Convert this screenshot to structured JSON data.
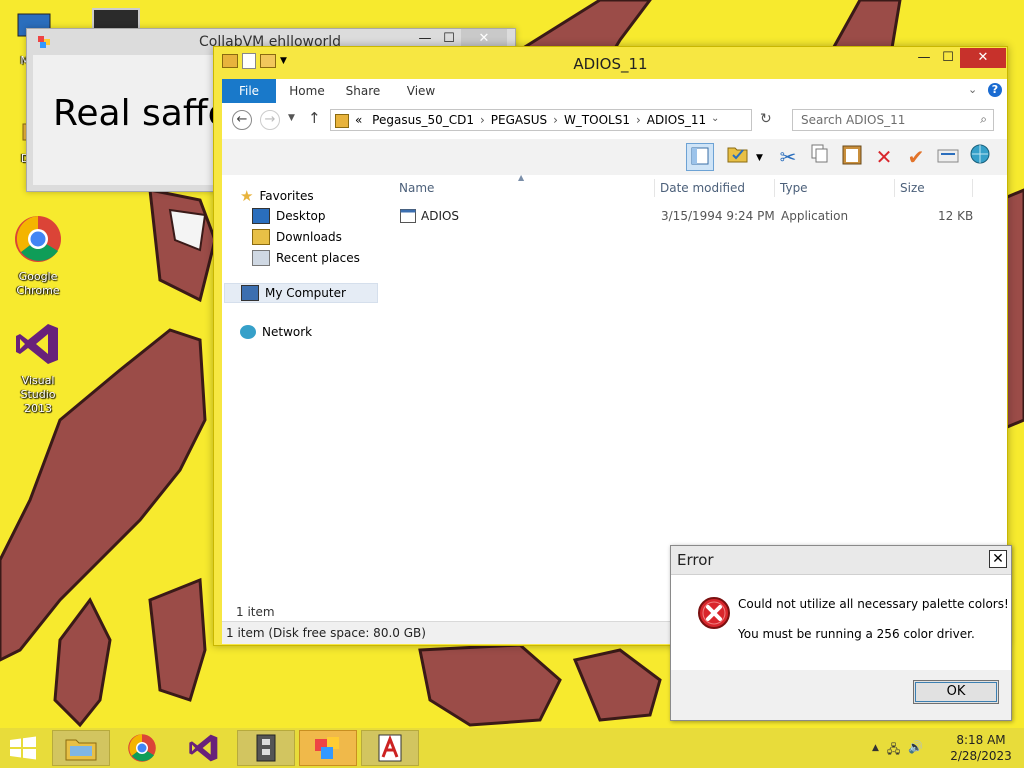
{
  "desktop": {
    "icons": [
      {
        "label": "My C",
        "icon": "computer-icon"
      },
      {
        "label": "Data",
        "icon": "folder-icon"
      },
      {
        "label": "Google Chrome",
        "icon": "chrome-icon"
      },
      {
        "label": "Visual Studio 2013",
        "icon": "visual-studio-icon"
      }
    ]
  },
  "collab_window": {
    "title": "CollabVM ehlloworld",
    "body_text": "Real saffe"
  },
  "explorer": {
    "title": "ADIOS_11",
    "ribbon_tabs": [
      "File",
      "Home",
      "Share",
      "View"
    ],
    "address": {
      "prefix": "«",
      "crumbs": [
        "Pegasus_50_CD1",
        "PEGASUS",
        "W_TOOLS1",
        "ADIOS_11"
      ]
    },
    "search_placeholder": "Search ADIOS_11",
    "nav": {
      "favorites": "Favorites",
      "desktop": "Desktop",
      "downloads": "Downloads",
      "recent": "Recent places",
      "my_computer": "My Computer",
      "network": "Network"
    },
    "columns": {
      "name": "Name",
      "date": "Date modified",
      "type": "Type",
      "size": "Size"
    },
    "files": [
      {
        "name": "ADIOS",
        "date": "3/15/1994 9:24 PM",
        "type": "Application",
        "size": "12 KB"
      }
    ],
    "status_count": "1 item",
    "status_disk": "1 item (Disk free space: 80.0 GB)"
  },
  "error_dialog": {
    "title": "Error",
    "line1": "Could not utilize all necessary palette colors!",
    "line2": "You must be running a 256 color driver.",
    "ok_label": "OK",
    "close_label": "✕"
  },
  "taskbar": {
    "apps": [
      "file-explorer-icon",
      "chrome-icon",
      "visual-studio-icon",
      "remote-app-icon",
      "collabvm-app-icon",
      "adios-app-icon"
    ],
    "time": "8:18 AM",
    "date": "2/28/2023"
  },
  "colors": {
    "desktop_bg": "#f7ea2e",
    "file_tab": "#1979ca",
    "close_red": "#c7312b",
    "error_red": "#d9262c"
  }
}
